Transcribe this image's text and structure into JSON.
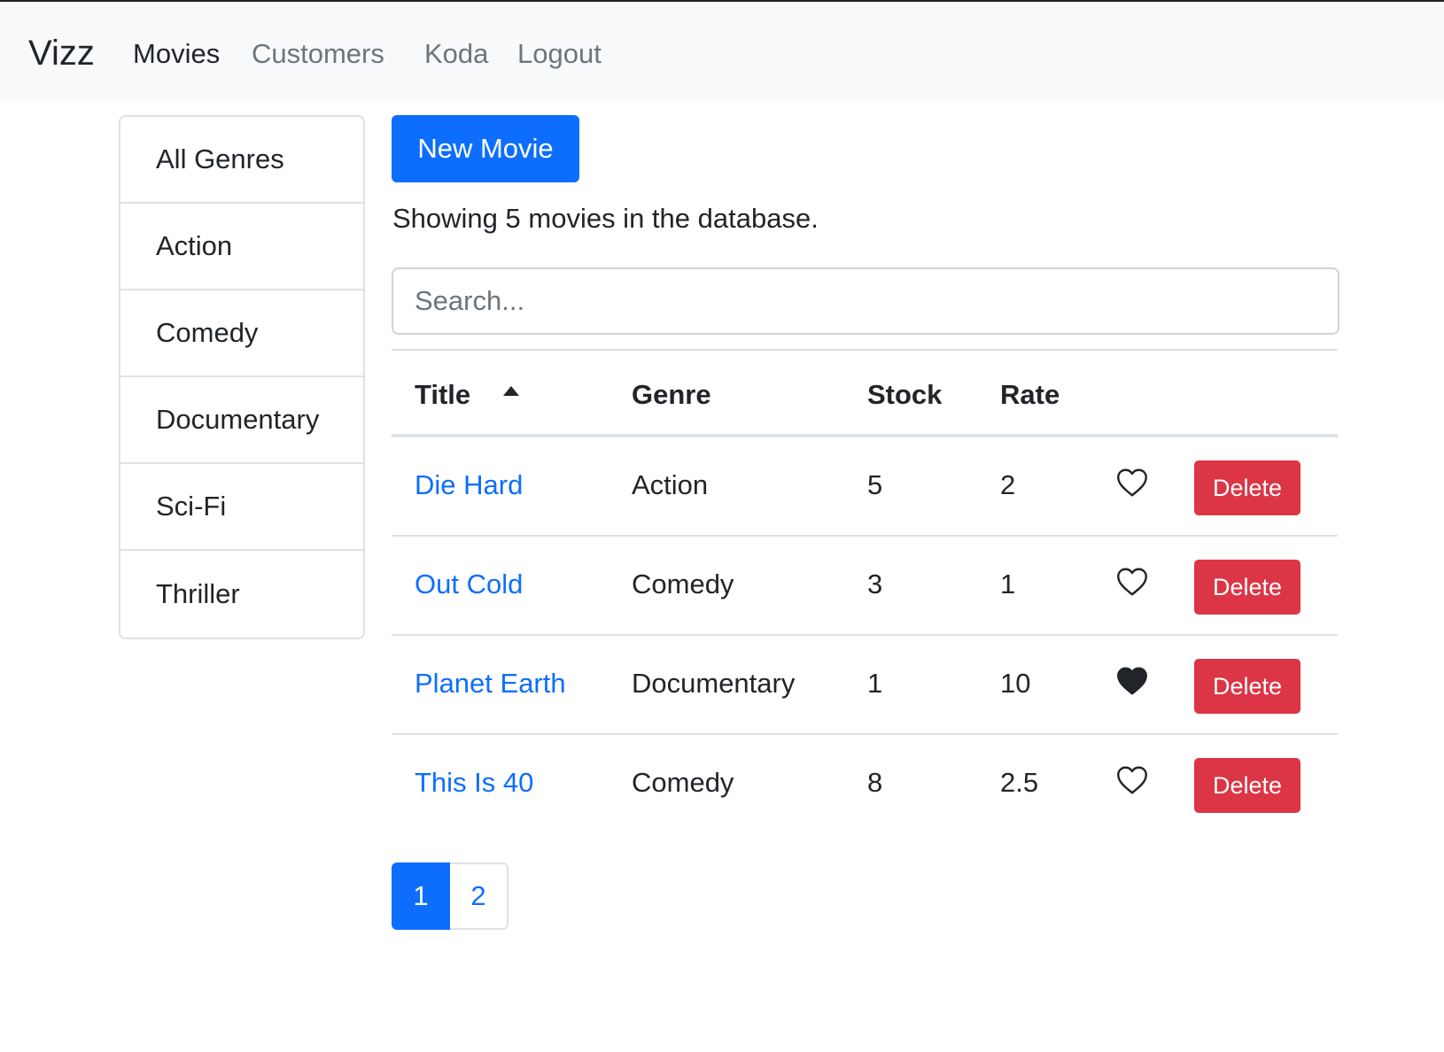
{
  "navbar": {
    "brand": "Vizz",
    "links": [
      {
        "label": "Movies",
        "active": true
      },
      {
        "label": "Customers",
        "active": false
      },
      {
        "label": "Koda",
        "active": false
      },
      {
        "label": "Logout",
        "active": false
      }
    ]
  },
  "sidebar": {
    "genres": [
      "All Genres",
      "Action",
      "Comedy",
      "Documentary",
      "Sci-Fi",
      "Thriller"
    ]
  },
  "main": {
    "new_button_label": "New Movie",
    "count_text": "Showing 5 movies in the database.",
    "search": {
      "placeholder": "Search...",
      "value": ""
    },
    "table": {
      "columns": [
        "Title",
        "Genre",
        "Stock",
        "Rate"
      ],
      "sort_column": "Title",
      "sort_direction": "asc",
      "rows": [
        {
          "title": "Die Hard",
          "genre": "Action",
          "stock": "5",
          "rate": "2",
          "liked": false,
          "delete_label": "Delete"
        },
        {
          "title": "Out Cold",
          "genre": "Comedy",
          "stock": "3",
          "rate": "1",
          "liked": false,
          "delete_label": "Delete"
        },
        {
          "title": "Planet Earth",
          "genre": "Documentary",
          "stock": "1",
          "rate": "10",
          "liked": true,
          "delete_label": "Delete"
        },
        {
          "title": "This Is 40",
          "genre": "Comedy",
          "stock": "8",
          "rate": "2.5",
          "liked": false,
          "delete_label": "Delete"
        }
      ]
    },
    "pagination": {
      "pages": [
        "1",
        "2"
      ],
      "current": "1"
    }
  },
  "colors": {
    "primary": "#0d6efd",
    "danger": "#dc3545",
    "navbar_bg": "#f8f9fa",
    "muted": "#6c757d"
  },
  "icons": {
    "like_empty": "heart-outline-icon",
    "like_filled": "heart-filled-icon",
    "sort": "caret-up-icon"
  }
}
